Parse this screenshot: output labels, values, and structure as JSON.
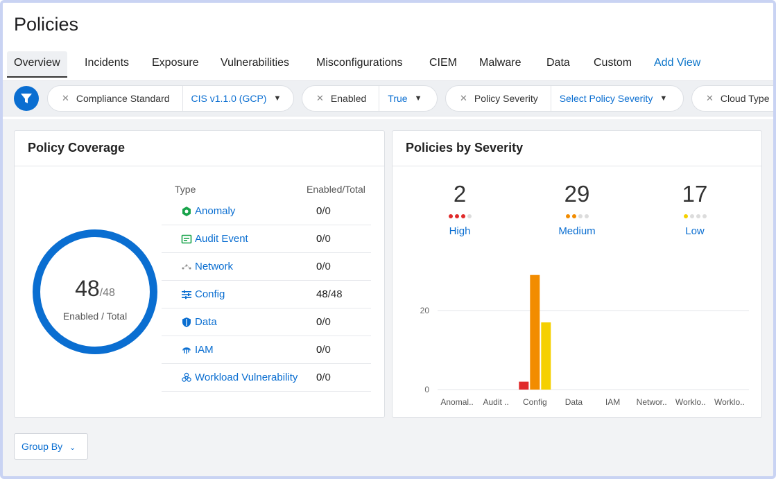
{
  "page": {
    "title": "Policies"
  },
  "tabs": [
    {
      "label": "Overview",
      "active": true
    },
    {
      "label": "Incidents"
    },
    {
      "label": "Exposure"
    },
    {
      "label": "Vulnerabilities"
    },
    {
      "label": "Misconfigurations"
    },
    {
      "label": "CIEM"
    },
    {
      "label": "Malware"
    },
    {
      "label": "Data"
    },
    {
      "label": "Custom"
    },
    {
      "label": "Add View"
    }
  ],
  "filters": [
    {
      "name": "Compliance Standard",
      "value": "CIS v1.1.0 (GCP)"
    },
    {
      "name": "Enabled",
      "value": "True"
    },
    {
      "name": "Policy Severity",
      "value": "Select Policy Severity"
    },
    {
      "name": "Cloud Type",
      "value": ""
    }
  ],
  "coverage": {
    "title": "Policy Coverage",
    "enabled": "48",
    "total": "/48",
    "center_label": "Enabled / Total",
    "col_type": "Type",
    "col_enabled": "Enabled/Total",
    "rows": [
      {
        "type": "Anomaly",
        "enabled": "0",
        "total": "/0",
        "icon": "anomaly-icon"
      },
      {
        "type": "Audit Event",
        "enabled": "0",
        "total": "/0",
        "icon": "audit-event-icon"
      },
      {
        "type": "Network",
        "enabled": "0",
        "total": "/0",
        "icon": "network-icon"
      },
      {
        "type": "Config",
        "enabled": "48",
        "total": "/48",
        "icon": "config-icon"
      },
      {
        "type": "Data",
        "enabled": "0",
        "total": "/0",
        "icon": "shield-icon"
      },
      {
        "type": "IAM",
        "enabled": "0",
        "total": "/0",
        "icon": "fingerprint-icon"
      },
      {
        "type": "Workload Vulnerability",
        "enabled": "0",
        "total": "/0",
        "icon": "biohazard-icon"
      }
    ]
  },
  "severity": {
    "title": "Policies by Severity",
    "levels": [
      {
        "count": "2",
        "label": "High",
        "filled": 3,
        "color": "#e02b2b"
      },
      {
        "count": "29",
        "label": "Medium",
        "filled": 2,
        "color": "#f28c00"
      },
      {
        "count": "17",
        "label": "Low",
        "filled": 1,
        "color": "#f5d000"
      }
    ]
  },
  "chart_data": {
    "type": "bar",
    "categories": [
      "Anomal..",
      "Audit ..",
      "Config",
      "Data",
      "IAM",
      "Networ..",
      "Worklo..",
      "Worklo.."
    ],
    "series": [
      {
        "name": "High",
        "color": "#e02b2b",
        "values": [
          0,
          0,
          2,
          0,
          0,
          0,
          0,
          0
        ]
      },
      {
        "name": "Medium",
        "color": "#f28c00",
        "values": [
          0,
          0,
          29,
          0,
          0,
          0,
          0,
          0
        ]
      },
      {
        "name": "Low",
        "color": "#f5d000",
        "values": [
          0,
          0,
          17,
          0,
          0,
          0,
          0,
          0
        ]
      }
    ],
    "yticks": [
      0,
      20
    ],
    "ylim": [
      0,
      29
    ],
    "grid": true
  },
  "footer": {
    "group_by": "Group By"
  },
  "colors": {
    "accent": "#0a6ed1",
    "high": "#e02b2b",
    "medium": "#f28c00",
    "low": "#f5d000"
  }
}
